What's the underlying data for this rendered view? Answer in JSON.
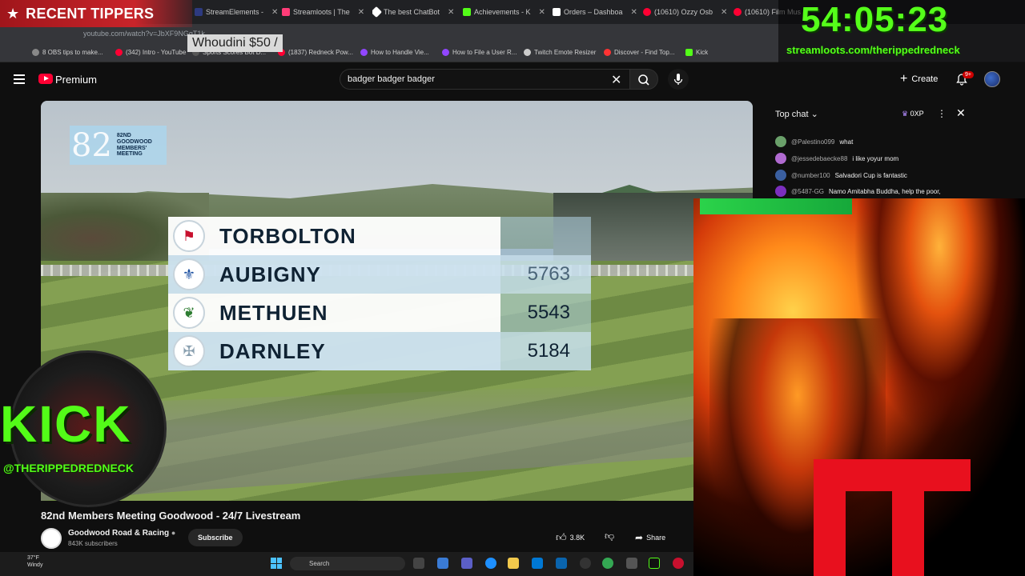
{
  "browser": {
    "tabs": [
      {
        "label": "StreamElements -",
        "color": "#2d3a80"
      },
      {
        "label": "Streamloots | The",
        "color": "#ff3c78"
      },
      {
        "label": "The best ChatBot",
        "color": "#ffffff"
      },
      {
        "label": "Achievements - K",
        "color": "#53fc18"
      },
      {
        "label": "Orders – Dashboa",
        "color": "#ffffff"
      },
      {
        "label": "(10610) Ozzy Osb",
        "color": "#ff0033"
      },
      {
        "label": "(10610) Film Mus",
        "color": "#ff0033"
      }
    ],
    "url": "youtube.com/watch?v=JbXF9NGgT1k",
    "bookmarks": [
      {
        "label": "8 OBS tips to make...",
        "color": "#888888"
      },
      {
        "label": "(342) Intro - YouTube",
        "color": "#ff0033"
      },
      {
        "label": "Sports Scores Bot D...",
        "color": "#555555"
      },
      {
        "label": "(1837) Redneck Pow...",
        "color": "#ff0033"
      },
      {
        "label": "How to Handle Vie...",
        "color": "#9146ff"
      },
      {
        "label": "How to File a User R...",
        "color": "#9146ff"
      },
      {
        "label": "Twitch Emote Resizer",
        "color": "#cccccc"
      },
      {
        "label": "Discover - Find Top...",
        "color": "#ff3333"
      },
      {
        "label": "Kick",
        "color": "#53fc18"
      }
    ]
  },
  "overlays": {
    "recent_tippers": "RECENT TIPPERS",
    "tipper_note": "Whoudini $50 /",
    "timer": "54:05:23",
    "timer_url": "streamloots.com/therippedredneck",
    "kick_text": "KICK",
    "kick_handle": "@THERIPPEDREDNECK"
  },
  "youtube": {
    "brand": "Premium",
    "search_value": "badger badger badger",
    "create_label": "Create",
    "notif_badge": "9+"
  },
  "video": {
    "event_number": "82",
    "event_text": "82nd Goodwood Members' Meeting",
    "leaderboard": [
      {
        "name": "TORBOLTON",
        "score": "",
        "crest": "⚑"
      },
      {
        "name": "AUBIGNY",
        "score": "5763",
        "crest": "⚜"
      },
      {
        "name": "METHUEN",
        "score": "5543",
        "crest": "❦"
      },
      {
        "name": "DARNLEY",
        "score": "5184",
        "crest": "✠"
      }
    ]
  },
  "chat": {
    "mode": "Top chat",
    "xp": "0XP",
    "messages": [
      {
        "user": "@Palestino099",
        "text": "what",
        "color": "#6aa06a"
      },
      {
        "user": "@jessedebaecke88",
        "text": "i like yoyur mom",
        "color": "#b06ad0"
      },
      {
        "user": "@number100",
        "text": "Salvadori Cup is fantastic",
        "color": "#3a5fa0"
      },
      {
        "user": "@5487-GG",
        "text": "Namo Amitabha Buddha, help the poor,",
        "color": "#7b2fbe"
      }
    ]
  },
  "meta": {
    "title": "82nd Members Meeting Goodwood - 24/7 Livestream",
    "channel": "Goodwood Road & Racing",
    "subscribers": "843K subscribers",
    "subscribe_label": "Subscribe",
    "likes": "3.8K",
    "share_label": "Share"
  },
  "taskbar": {
    "temperature": "37°F",
    "condition": "Windy",
    "search_label": "Search"
  }
}
